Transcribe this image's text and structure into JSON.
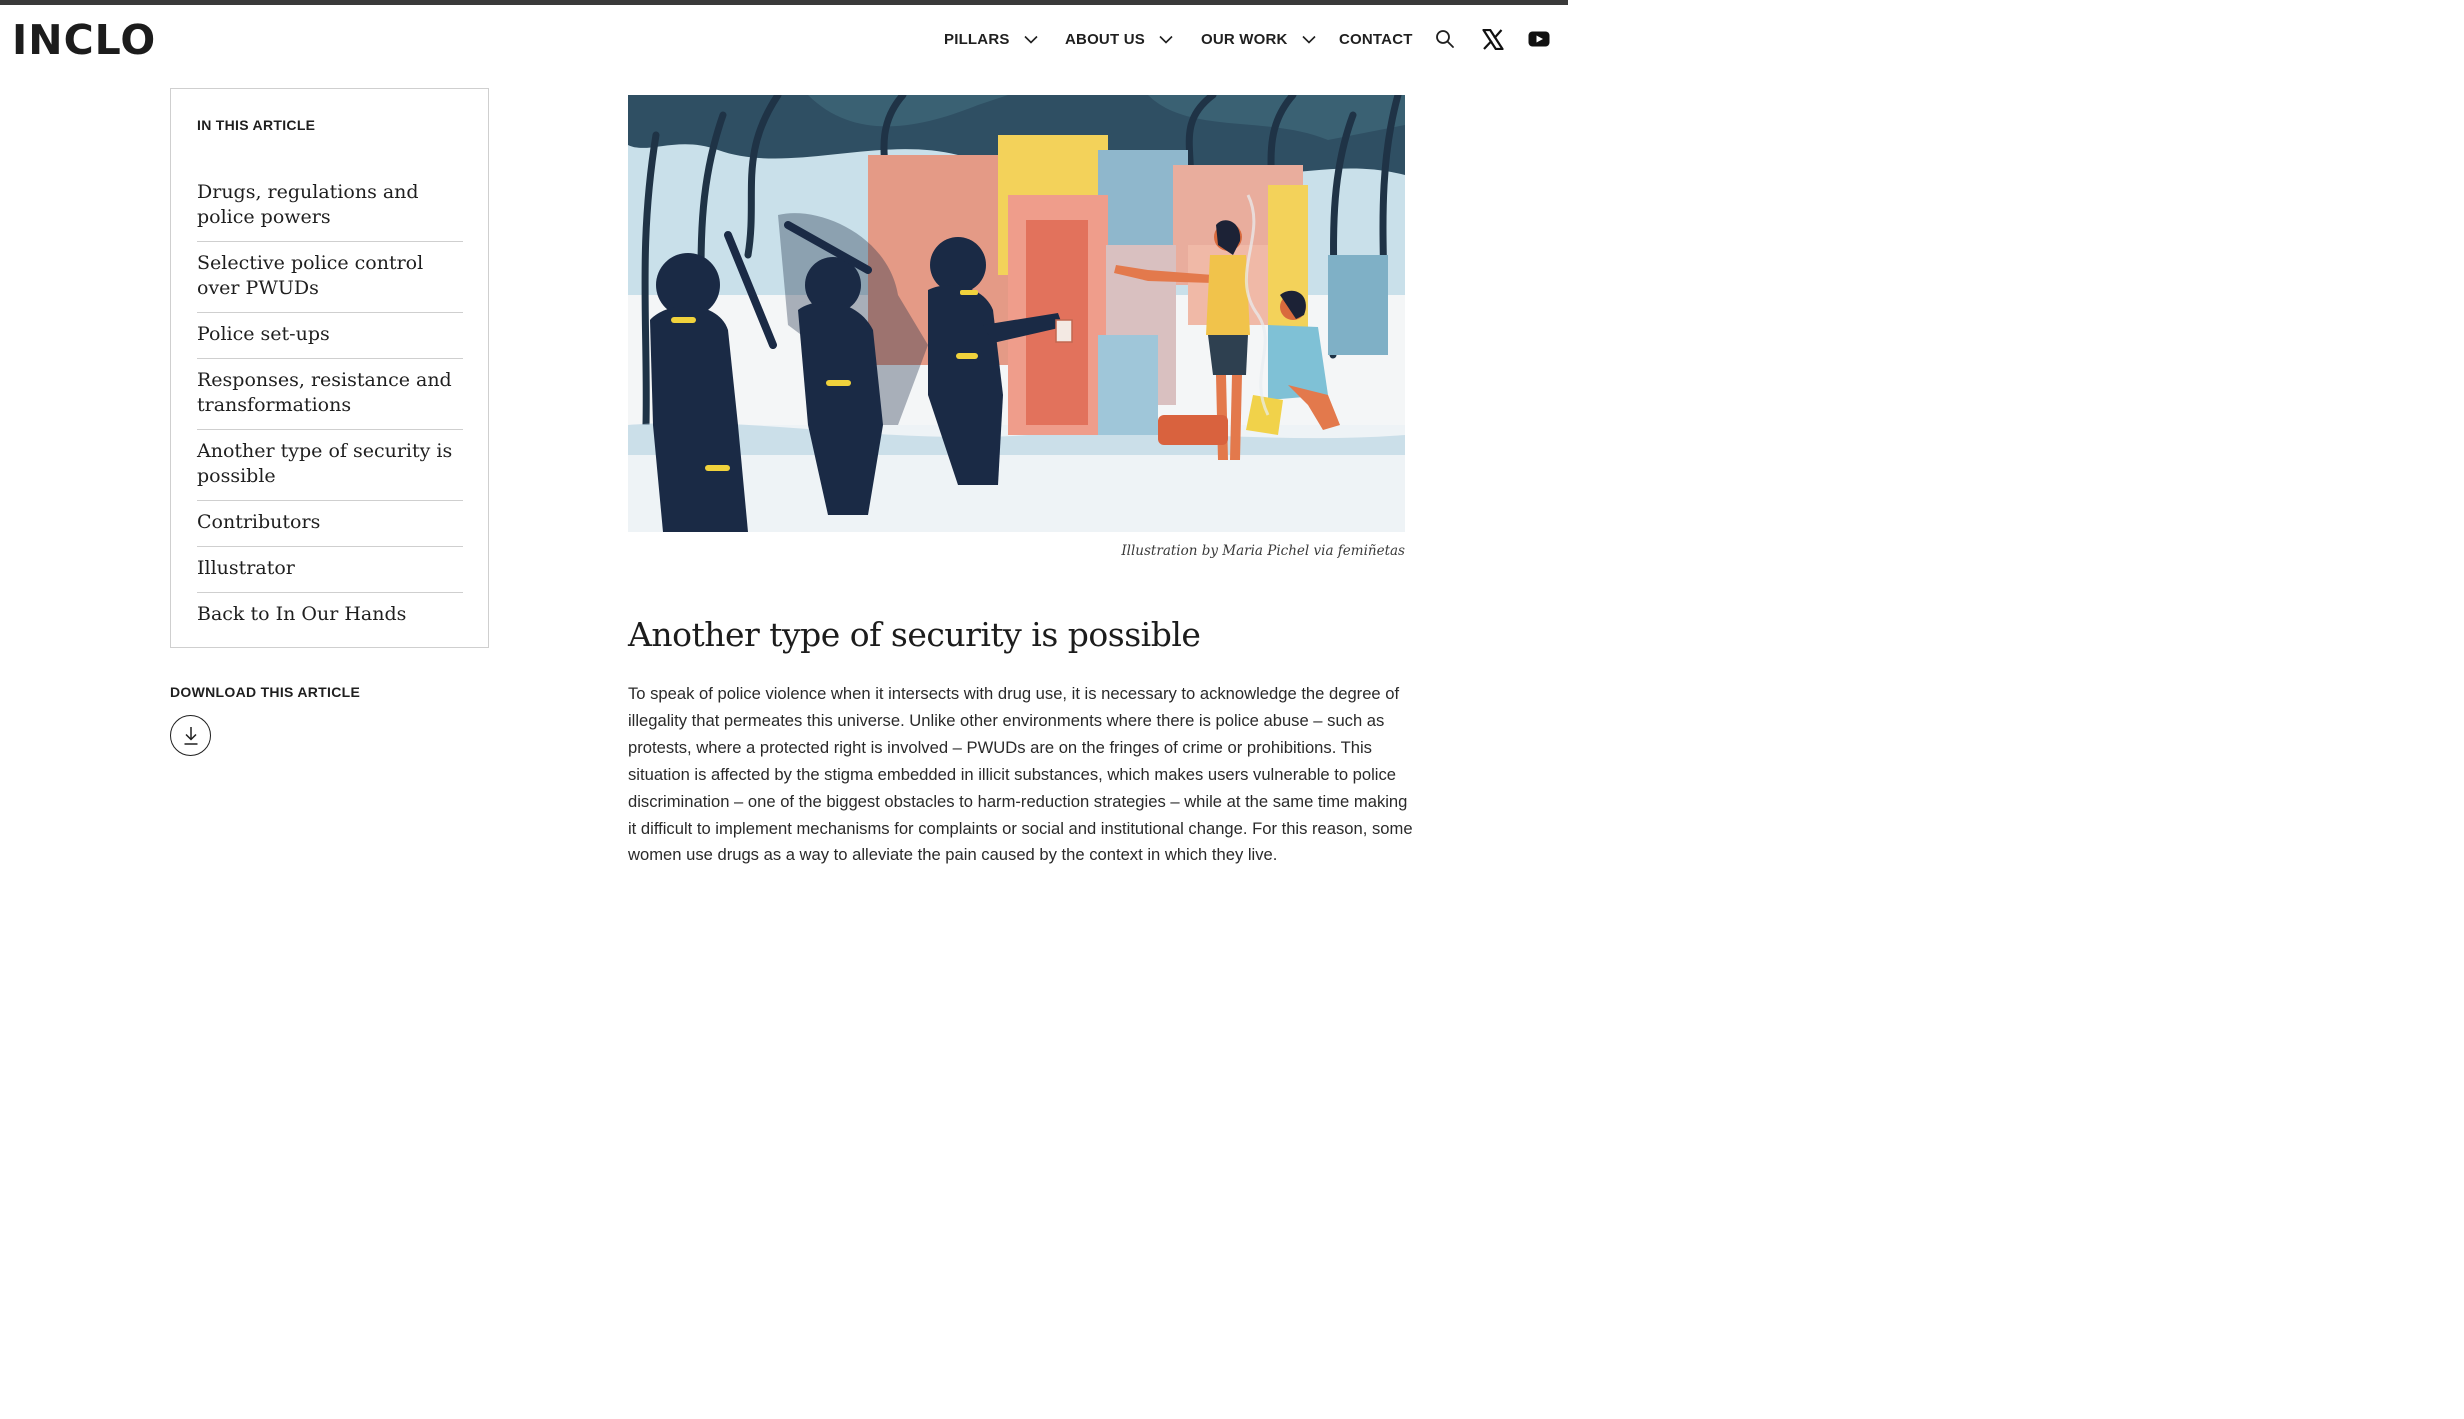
{
  "header": {
    "logo": "INCLO",
    "nav": [
      {
        "label": "PILLARS",
        "has_dropdown": true
      },
      {
        "label": "ABOUT US",
        "has_dropdown": true
      },
      {
        "label": "OUR WORK",
        "has_dropdown": true
      },
      {
        "label": "CONTACT",
        "has_dropdown": false
      }
    ],
    "icons": [
      "search-icon",
      "x-twitter-icon",
      "youtube-icon"
    ]
  },
  "toc": {
    "heading": "IN THIS ARTICLE",
    "items": [
      "Drugs, regulations and police powers",
      "Selective police control over PWUDs",
      "Police set-ups",
      "Responses, resistance and transformations",
      "Another type of security is possible",
      "Contributors",
      "Illustrator",
      "Back to In Our Hands"
    ]
  },
  "download": {
    "heading": "DOWNLOAD THIS ARTICLE",
    "icon": "download-icon"
  },
  "article": {
    "caption": "Illustration by Maria Pichel via femiñetas",
    "title": "Another type of security is possible",
    "body": "To speak of police violence when it intersects with drug use, it is necessary to acknowledge the degree of illegality that permeates this universe. Unlike other environments where there is police abuse – such as protests, where a protected right is involved – PWUDs are on the fringes of crime or prohibitions. This situation is affected by the stigma embedded in illicit substances, which makes users vulnerable to police discrimination – one of the biggest obstacles to harm-reduction strategies – while at the same time making it difficult to implement mechanisms for complaints or social and institutional change. For this reason, some women use drugs as a way to alleviate the pain caused by the context in which they live."
  },
  "colors": {
    "text": "#1f1f1f",
    "border": "#cfcfcf",
    "police_navy": "#1a2a45",
    "shelter_coral": "#e07e6a",
    "shelter_yellow": "#f3d25a",
    "sky_blue": "#a9cde0"
  }
}
